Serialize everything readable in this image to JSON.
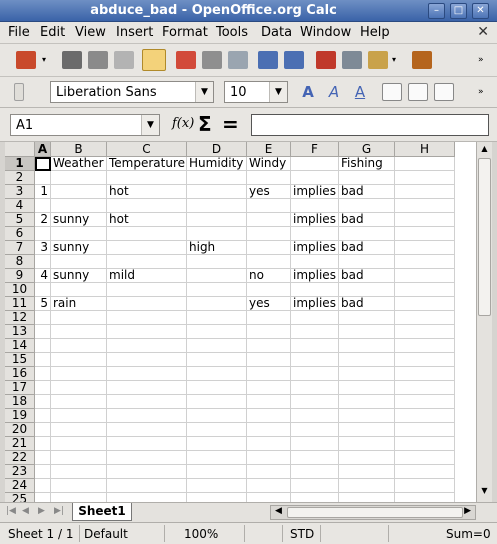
{
  "window": {
    "title": "abduce_bad - OpenOffice.org Calc"
  },
  "menu": [
    "File",
    "Edit",
    "View",
    "Insert",
    "Format",
    "Tools",
    "Data",
    "Window",
    "Help"
  ],
  "formatting": {
    "font_name": "Liberation Sans",
    "font_size": "10"
  },
  "formula_bar": {
    "cell_ref": "A1",
    "func_label": "f(x)",
    "sum_symbol": "Σ",
    "equals_symbol": "=",
    "formula": ""
  },
  "columns": [
    "A",
    "B",
    "C",
    "D",
    "E",
    "F",
    "G",
    "H"
  ],
  "rows": [
    {
      "n": "1",
      "cells": [
        "",
        "Weather",
        "Temperature",
        "Humidity",
        "Windy",
        "",
        "Fishing",
        ""
      ]
    },
    {
      "n": "2",
      "cells": [
        "",
        "",
        "",
        "",
        "",
        "",
        "",
        ""
      ]
    },
    {
      "n": "3",
      "cells": [
        "1",
        "",
        "hot",
        "",
        "yes",
        "implies",
        "bad",
        ""
      ]
    },
    {
      "n": "4",
      "cells": [
        "",
        "",
        "",
        "",
        "",
        "",
        "",
        ""
      ]
    },
    {
      "n": "5",
      "cells": [
        "2",
        "sunny",
        "hot",
        "",
        "",
        "implies",
        "bad",
        ""
      ]
    },
    {
      "n": "6",
      "cells": [
        "",
        "",
        "",
        "",
        "",
        "",
        "",
        ""
      ]
    },
    {
      "n": "7",
      "cells": [
        "3",
        "sunny",
        "",
        "high",
        "",
        "implies",
        "bad",
        ""
      ]
    },
    {
      "n": "8",
      "cells": [
        "",
        "",
        "",
        "",
        "",
        "",
        "",
        ""
      ]
    },
    {
      "n": "9",
      "cells": [
        "4",
        "sunny",
        "mild",
        "",
        "no",
        "implies",
        "bad",
        ""
      ]
    },
    {
      "n": "10",
      "cells": [
        "",
        "",
        "",
        "",
        "",
        "",
        "",
        ""
      ]
    },
    {
      "n": "11",
      "cells": [
        "5",
        "rain",
        "",
        "",
        "yes",
        "implies",
        "bad",
        ""
      ]
    },
    {
      "n": "12",
      "cells": [
        "",
        "",
        "",
        "",
        "",
        "",
        "",
        ""
      ]
    },
    {
      "n": "13",
      "cells": [
        "",
        "",
        "",
        "",
        "",
        "",
        "",
        ""
      ]
    },
    {
      "n": "14",
      "cells": [
        "",
        "",
        "",
        "",
        "",
        "",
        "",
        ""
      ]
    },
    {
      "n": "15",
      "cells": [
        "",
        "",
        "",
        "",
        "",
        "",
        "",
        ""
      ]
    },
    {
      "n": "16",
      "cells": [
        "",
        "",
        "",
        "",
        "",
        "",
        "",
        ""
      ]
    },
    {
      "n": "17",
      "cells": [
        "",
        "",
        "",
        "",
        "",
        "",
        "",
        ""
      ]
    },
    {
      "n": "18",
      "cells": [
        "",
        "",
        "",
        "",
        "",
        "",
        "",
        ""
      ]
    },
    {
      "n": "19",
      "cells": [
        "",
        "",
        "",
        "",
        "",
        "",
        "",
        ""
      ]
    },
    {
      "n": "20",
      "cells": [
        "",
        "",
        "",
        "",
        "",
        "",
        "",
        ""
      ]
    },
    {
      "n": "21",
      "cells": [
        "",
        "",
        "",
        "",
        "",
        "",
        "",
        ""
      ]
    },
    {
      "n": "22",
      "cells": [
        "",
        "",
        "",
        "",
        "",
        "",
        "",
        ""
      ]
    },
    {
      "n": "23",
      "cells": [
        "",
        "",
        "",
        "",
        "",
        "",
        "",
        ""
      ]
    },
    {
      "n": "24",
      "cells": [
        "",
        "",
        "",
        "",
        "",
        "",
        "",
        ""
      ]
    },
    {
      "n": "25",
      "cells": [
        "",
        "",
        "",
        "",
        "",
        "",
        "",
        ""
      ]
    }
  ],
  "sheet_tab": "Sheet1",
  "status": {
    "sheet": "Sheet 1 / 1",
    "style": "Default",
    "zoom": "100%",
    "mode": "STD",
    "sum": "Sum=0"
  }
}
